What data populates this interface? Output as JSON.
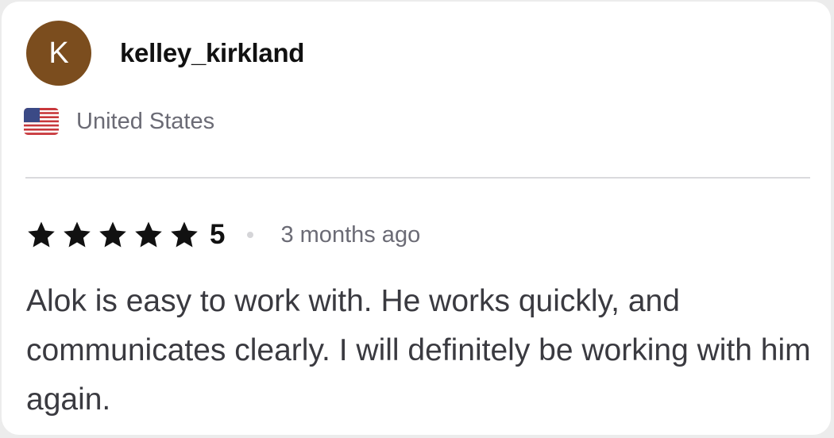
{
  "review": {
    "avatar_initial": "K",
    "username": "kelley_kirkland",
    "country": "United States",
    "flag_icon": "us-flag-icon",
    "rating": {
      "stars": 5,
      "value": "5"
    },
    "time_ago": "3 months ago",
    "text": "Alok is easy to work with. He works quickly, and communicates clearly. I will definitely be working with him again."
  },
  "colors": {
    "avatar_bg": "#7b4d1e",
    "star": "#111111",
    "muted_text": "#6b6b75",
    "body_text": "#3a3a40"
  }
}
